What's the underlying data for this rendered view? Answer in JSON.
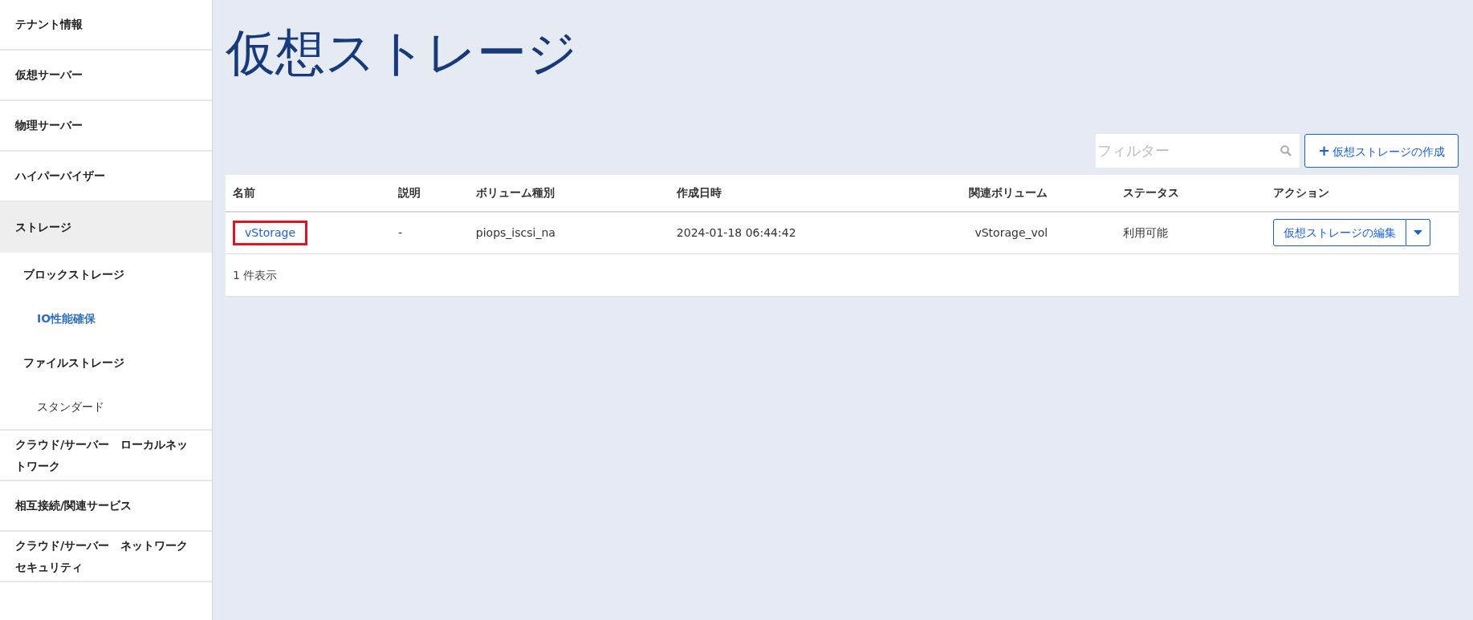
{
  "sidebar": {
    "items": [
      {
        "label": "テナント情報",
        "selected": false
      },
      {
        "label": "仮想サーバー",
        "selected": false
      },
      {
        "label": "物理サーバー",
        "selected": false
      },
      {
        "label": "ハイパーバイザー",
        "selected": false
      },
      {
        "label": "ストレージ",
        "selected": true,
        "children": [
          {
            "label": "ブロックストレージ",
            "selected": false,
            "children": [
              {
                "label": "IO性能確保",
                "selected": true
              }
            ]
          },
          {
            "label": "ファイルストレージ",
            "selected": false,
            "children": [
              {
                "label": "スタンダード",
                "selected": false
              }
            ]
          }
        ]
      },
      {
        "label": "クラウド/サーバー　ローカルネットワーク",
        "selected": false
      },
      {
        "label": "相互接続/関連サービス",
        "selected": false
      },
      {
        "label": "クラウド/サーバー　ネットワークセキュリティ",
        "selected": false
      }
    ]
  },
  "page_title": "仮想ストレージ",
  "filter": {
    "placeholder": "フィルター"
  },
  "create_button": {
    "icon": "+",
    "label": "仮想ストレージの作成"
  },
  "table": {
    "columns": [
      "名前",
      "説明",
      "ボリューム種別",
      "作成日時",
      "関連ボリューム",
      "ステータス",
      "アクション"
    ],
    "rows": [
      {
        "name": "vStorage",
        "highlighted": true,
        "description": "-",
        "volume_type": "piops_iscsi_na",
        "created": "2024-01-18 06:44:42",
        "related_volume": "vStorage_vol",
        "status": "利用可能",
        "action": "仮想ストレージの編集"
      }
    ],
    "footer": "1 件表示"
  }
}
